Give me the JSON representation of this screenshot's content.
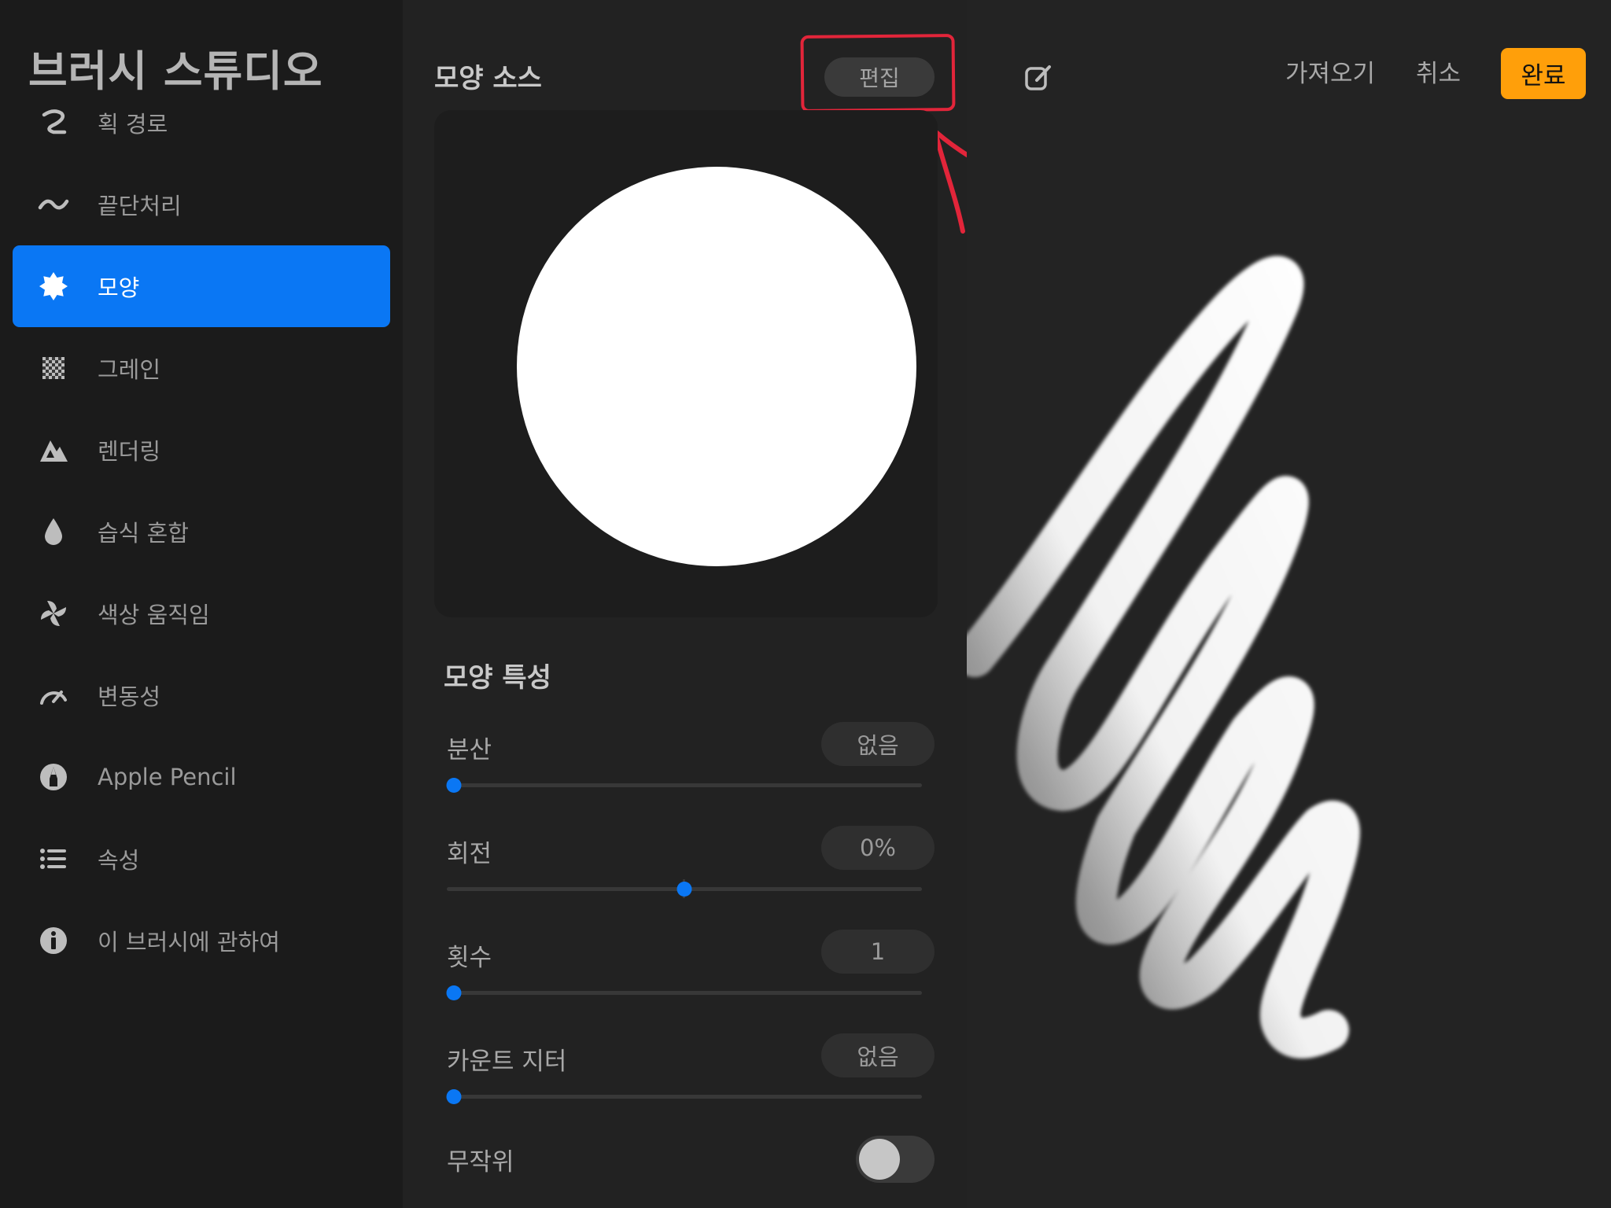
{
  "sidebar": {
    "title": "브러시 스튜디오",
    "items": [
      {
        "label": "획 경로",
        "icon": "stroke-path-icon",
        "active": false
      },
      {
        "label": "끝단처리",
        "icon": "taper-icon",
        "active": false
      },
      {
        "label": "모양",
        "icon": "shape-icon",
        "active": true
      },
      {
        "label": "그레인",
        "icon": "grain-icon",
        "active": false
      },
      {
        "label": "렌더링",
        "icon": "rendering-icon",
        "active": false
      },
      {
        "label": "습식 혼합",
        "icon": "wet-mix-icon",
        "active": false
      },
      {
        "label": "색상 움직임",
        "icon": "color-dynamics-icon",
        "active": false
      },
      {
        "label": "변동성",
        "icon": "dynamics-icon",
        "active": false
      },
      {
        "label": "Apple Pencil",
        "icon": "apple-pencil-icon",
        "active": false
      },
      {
        "label": "속성",
        "icon": "properties-icon",
        "active": false
      },
      {
        "label": "이 브러시에 관하여",
        "icon": "info-icon",
        "active": false
      }
    ]
  },
  "shape_source": {
    "title": "모양 소스",
    "edit_label": "편집"
  },
  "shape_properties": {
    "title": "모양 특성",
    "scatter": {
      "label": "분산",
      "value": "없음",
      "slider": 0.0
    },
    "rotation": {
      "label": "회전",
      "value": "0%",
      "slider": 0.5
    },
    "count": {
      "label": "횟수",
      "value": "1",
      "slider": 0.0
    },
    "count_jitter": {
      "label": "카운트 지터",
      "value": "없음",
      "slider": 0.0
    },
    "randomized": {
      "label": "무작위",
      "on": false
    }
  },
  "drawing_pad": {
    "import_label": "가져오기",
    "cancel_label": "취소",
    "done_label": "완료",
    "edit_icon": "pencil-square-icon"
  },
  "colors": {
    "accent": "#0a77f4",
    "done": "#ff9f0a",
    "annotation": "#e2253a"
  }
}
